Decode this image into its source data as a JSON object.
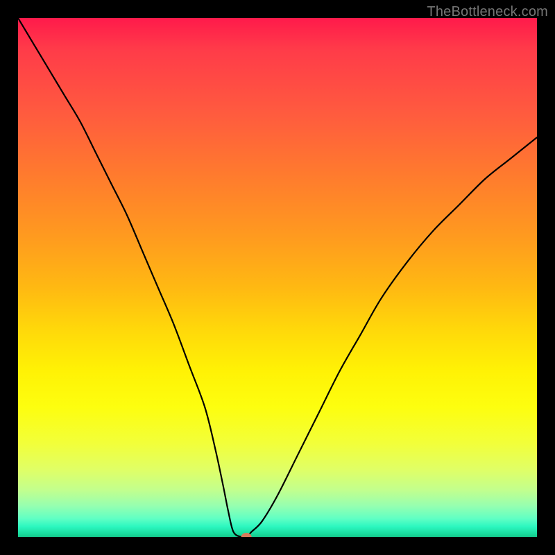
{
  "watermark": {
    "text": "TheBottleneck.com"
  },
  "colors": {
    "gradient_top": "#ff1a4b",
    "gradient_mid": "#ffd80a",
    "gradient_bottom": "#16c78b",
    "curve": "#000000",
    "marker": "#d87a5a",
    "frame": "#000000"
  },
  "chart_data": {
    "type": "line",
    "title": "",
    "xlabel": "",
    "ylabel": "",
    "xlim": [
      0,
      100
    ],
    "ylim": [
      0,
      100
    ],
    "grid": false,
    "legend": false,
    "series": [
      {
        "name": "bottleneck-curve",
        "x": [
          0,
          3,
          6,
          9,
          12,
          15,
          18,
          21,
          24,
          27,
          30,
          33,
          36,
          38,
          39.5,
          40.5,
          41.5,
          43,
          44,
          45,
          47,
          50,
          54,
          58,
          62,
          66,
          70,
          75,
          80,
          85,
          90,
          95,
          100
        ],
        "y": [
          100,
          95,
          90,
          85,
          80,
          74,
          68,
          62,
          55,
          48,
          41,
          33,
          25,
          17,
          10,
          5,
          1,
          0,
          0,
          1,
          3,
          8,
          16,
          24,
          32,
          39,
          46,
          53,
          59,
          64,
          69,
          73,
          77
        ]
      }
    ],
    "marker": {
      "x": 44,
      "y": 0
    },
    "annotations": []
  }
}
